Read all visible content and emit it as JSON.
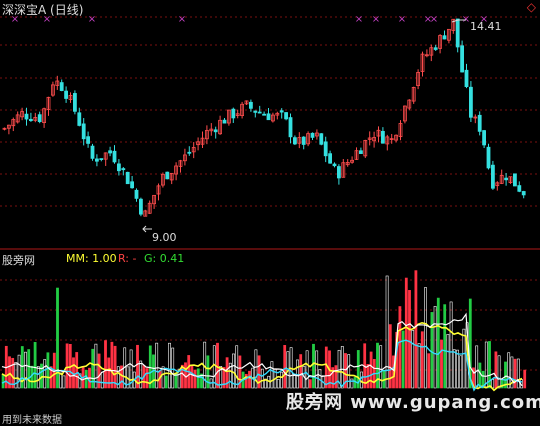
{
  "header": {
    "title": "深深宝A (日线)",
    "corner_icon": "diamond-icon",
    "corner_glyph": "◇"
  },
  "price_panel": {
    "high_label": "14.41",
    "low_label": "9.00",
    "high_value": 14.41,
    "low_value": 9.0,
    "marker_glyph": "×",
    "colors": {
      "up": "#ff4d4d",
      "down": "#35e0e0",
      "grid": "#7a1010",
      "marker": "#c040c0"
    }
  },
  "indicator_panel": {
    "name": "股旁网",
    "mm_label": "MM: 1.00",
    "r_label": "R: -",
    "g_label": "G: 0.41",
    "colors": {
      "white": "#ffffff",
      "red": "#ff3344",
      "green": "#22cc44",
      "yellow": "#ffff33",
      "cyan": "#33ddff"
    }
  },
  "footer": {
    "note": "用到未来数据",
    "watermark": "股旁网 www.gupang.com"
  }
}
